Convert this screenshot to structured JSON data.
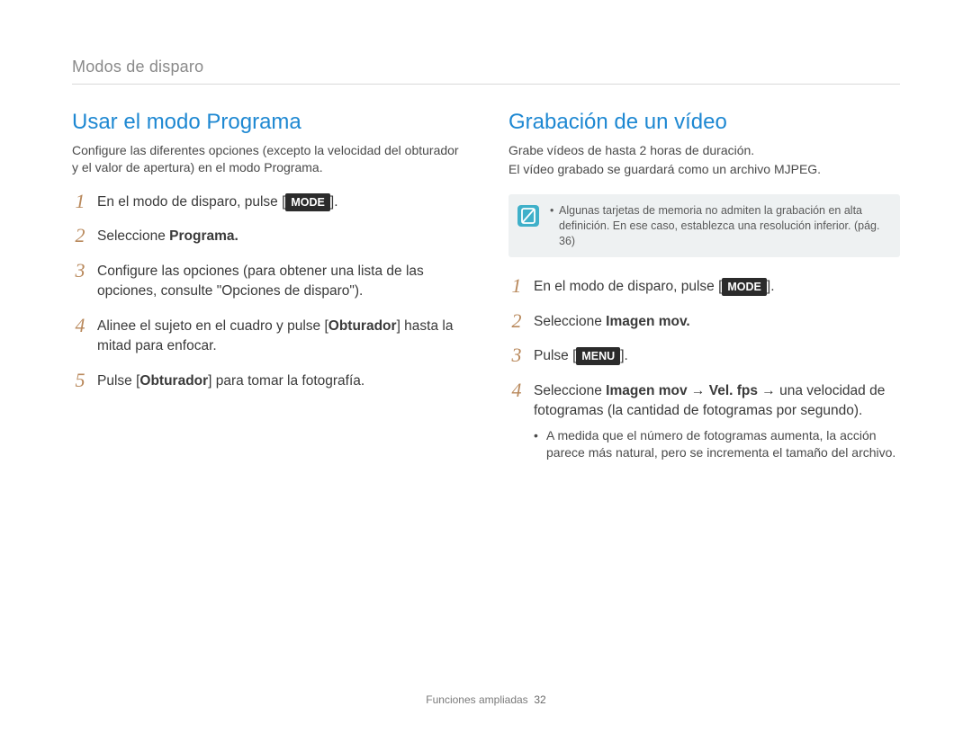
{
  "breadcrumb": "Modos de disparo",
  "left": {
    "title": "Usar el modo Programa",
    "intro": "Configure las diferentes opciones (excepto la velocidad del obturador y el valor de apertura) en el modo Programa.",
    "steps": [
      {
        "num": "1",
        "pre": "En el modo de disparo, pulse [",
        "btn": "MODE",
        "post": "]."
      },
      {
        "num": "2",
        "pre": "Seleccione ",
        "bold": "Programa.",
        "post": ""
      },
      {
        "num": "3",
        "plain": "Configure las opciones (para obtener una lista de las opciones, consulte \"Opciones de disparo\")."
      },
      {
        "num": "4",
        "pre": "Alinee el sujeto en el cuadro y pulse [",
        "bold_inline": "Obturador",
        "post": "] hasta la mitad para enfocar."
      },
      {
        "num": "5",
        "pre": "Pulse [",
        "bold_inline": "Obturador",
        "post": "] para tomar la fotografía."
      }
    ]
  },
  "right": {
    "title": "Grabación de un vídeo",
    "intro_line1": "Grabe vídeos de hasta 2 horas de duración.",
    "intro_line2": "El vídeo grabado se guardará como un archivo MJPEG.",
    "note": "Algunas tarjetas de memoria no admiten la grabación en alta definición. En ese caso, establezca una resolución inferior. (pág. 36)",
    "steps": [
      {
        "num": "1",
        "pre": "En el modo de disparo, pulse [",
        "btn": "MODE",
        "post": "]."
      },
      {
        "num": "2",
        "pre": "Seleccione ",
        "bold": "Imagen mov.",
        "post": ""
      },
      {
        "num": "3",
        "pre": "Pulse [",
        "btn": "MENU",
        "post": "]."
      },
      {
        "num": "4",
        "pre": "Seleccione ",
        "bold_a": "Imagen mov",
        "mid": " → ",
        "bold_b": "Vel. fps",
        "post": " → una velocidad de fotogramas (la cantidad de fotogramas por segundo).",
        "bullets": [
          "A medida que el número de fotogramas aumenta, la acción parece más natural, pero se incrementa el tamaño del archivo."
        ]
      }
    ]
  },
  "footer": {
    "section": "Funciones ampliadas",
    "page": "32"
  }
}
